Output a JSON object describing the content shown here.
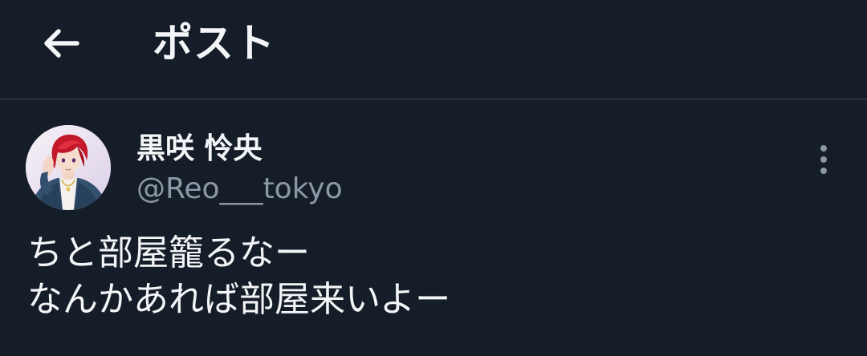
{
  "header": {
    "back_icon": "arrow-left-icon",
    "title": "ポスト"
  },
  "post": {
    "author": {
      "display_name": "黒咲 怜央",
      "handle": "@Reo___tokyo"
    },
    "more_icon": "more-vertical-icon",
    "text_lines": [
      "ちと部屋籠るなー",
      "なんかあれば部屋来いよー"
    ]
  },
  "colors": {
    "background": "#151d28",
    "divider": "#38444d",
    "primary_text": "#f3f5f7",
    "secondary_text": "#8b98a5"
  }
}
